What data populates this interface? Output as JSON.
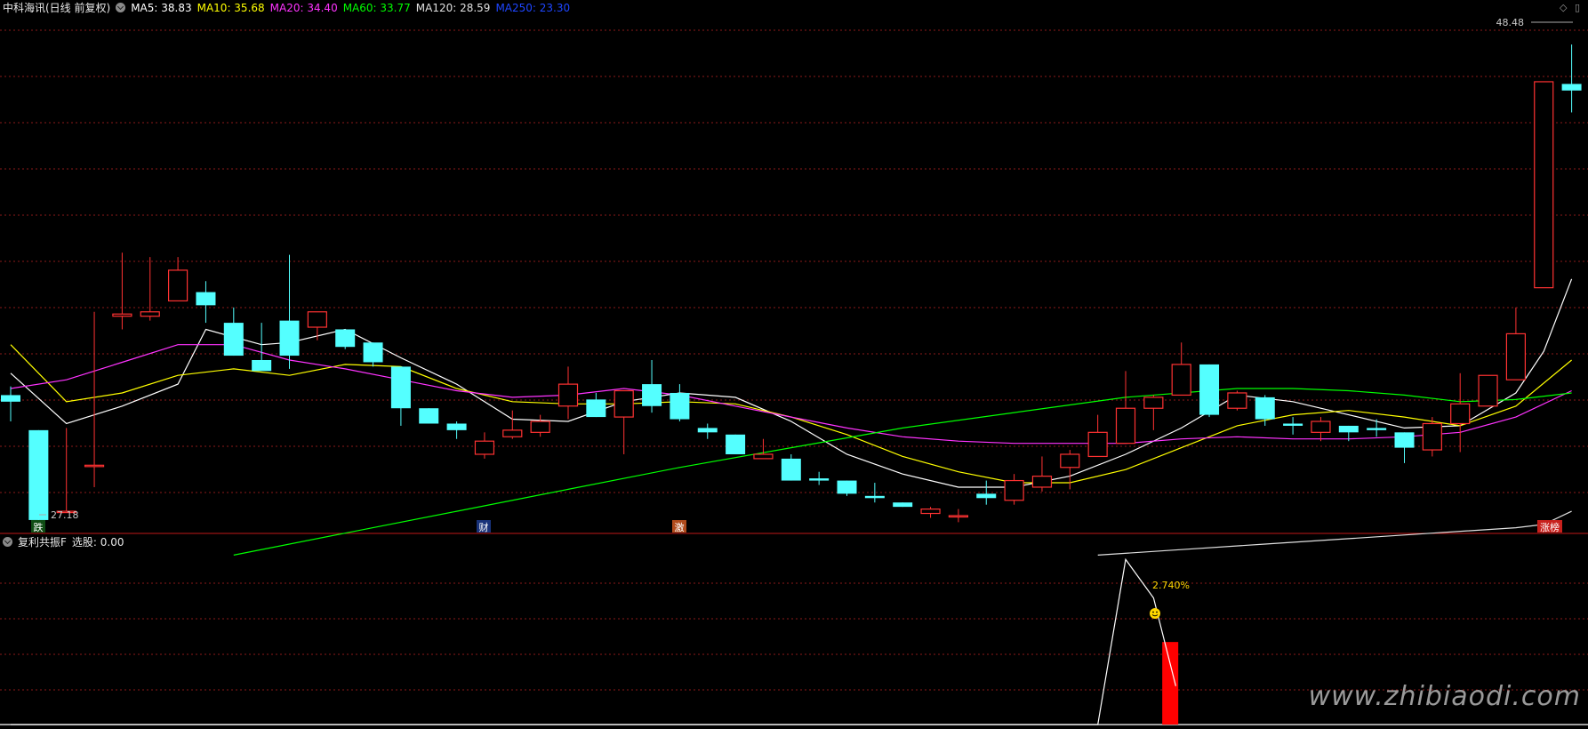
{
  "main_header": {
    "title": "中科海讯(日线 前复权)",
    "ma": [
      {
        "label": "MA5: 38.83",
        "color": "#ffffff"
      },
      {
        "label": "MA10: 35.68",
        "color": "#ffff00"
      },
      {
        "label": "MA20: 34.40",
        "color": "#ff33ff"
      },
      {
        "label": "MA60: 33.77",
        "color": "#00ff00"
      },
      {
        "label": "MA120: 28.59",
        "color": "#e0e0e0"
      },
      {
        "label": "MA250: 23.30",
        "color": "#1e46ff"
      }
    ]
  },
  "sub_header": {
    "title": "复利共振F",
    "value_label": "选股: 0.00"
  },
  "annotations": {
    "high_label": "48.48",
    "low_label": "27.18",
    "marker_die": "跌",
    "marker_cai": "财",
    "marker_ji": "激",
    "marker_zhangting": "涨榜",
    "pct_label": "2.740%"
  },
  "watermark": "www.zhibiaodi.com",
  "colors": {
    "up": "#ff3232",
    "down": "#54ffff",
    "grid": "#8b1a1a",
    "ma5": "#ffffff",
    "ma10": "#ffff00",
    "ma20": "#ff33ff",
    "ma60": "#00ff00",
    "ma120": "#e0e0e0",
    "signal_bar": "#ff0000"
  },
  "chart_data": [
    {
      "type": "candlestick",
      "ylim": [
        27.0,
        49.8
      ],
      "candles": [
        [
          32.5,
          32.9,
          32.2,
          31.3
        ],
        [
          30.9,
          30.9,
          26.8,
          26.7
        ],
        [
          27.2,
          31.0,
          27.2,
          28.3
        ],
        [
          29.3,
          36.3,
          29.3,
          28.3
        ],
        [
          36.1,
          39.0,
          36.2,
          35.5
        ],
        [
          36.1,
          38.8,
          36.3,
          35.9
        ],
        [
          36.8,
          38.8,
          38.2,
          36.8
        ],
        [
          37.2,
          37.7,
          36.6,
          35.8
        ],
        [
          35.8,
          36.5,
          34.3,
          34.3
        ],
        [
          34.1,
          35.8,
          33.6,
          33.7
        ],
        [
          35.9,
          38.9,
          34.3,
          33.7
        ],
        [
          35.6,
          35.9,
          36.3,
          35.0
        ],
        [
          35.5,
          35.5,
          34.7,
          34.6
        ],
        [
          34.9,
          34.9,
          34.0,
          33.8
        ],
        [
          33.8,
          33.8,
          31.9,
          31.1
        ],
        [
          31.9,
          31.9,
          31.2,
          31.2
        ],
        [
          31.2,
          31.3,
          30.9,
          30.5
        ],
        [
          29.8,
          30.8,
          30.4,
          29.6
        ],
        [
          30.6,
          31.8,
          30.9,
          30.5
        ],
        [
          30.8,
          31.6,
          31.3,
          30.6
        ],
        [
          32.0,
          33.8,
          33.0,
          31.4
        ],
        [
          32.3,
          32.6,
          31.5,
          31.5
        ],
        [
          31.5,
          32.1,
          32.7,
          29.8
        ],
        [
          33.0,
          34.1,
          32.0,
          31.7
        ],
        [
          32.6,
          33.0,
          31.4,
          31.3
        ],
        [
          31.0,
          31.2,
          30.8,
          30.5
        ],
        [
          30.7,
          30.7,
          29.8,
          29.8
        ],
        [
          29.6,
          30.5,
          29.8,
          29.6
        ],
        [
          29.6,
          29.8,
          28.6,
          28.6
        ],
        [
          28.7,
          29.0,
          28.6,
          28.4
        ],
        [
          28.6,
          28.6,
          28.0,
          27.9
        ],
        [
          27.9,
          28.5,
          27.8,
          27.6
        ],
        [
          27.6,
          27.6,
          27.4,
          27.4
        ],
        [
          27.1,
          27.4,
          27.3,
          26.9
        ],
        [
          27.0,
          27.3,
          27.0,
          26.7
        ],
        [
          28.0,
          28.6,
          27.8,
          27.5
        ],
        [
          27.7,
          28.9,
          28.6,
          27.5
        ],
        [
          28.3,
          29.7,
          28.8,
          28.1
        ],
        [
          29.2,
          30.0,
          29.8,
          28.2
        ],
        [
          29.7,
          31.6,
          30.8,
          30.0
        ],
        [
          30.3,
          33.6,
          31.9,
          30.3
        ],
        [
          31.9,
          32.5,
          32.4,
          30.9
        ],
        [
          32.5,
          34.9,
          33.9,
          32.5
        ],
        [
          33.9,
          33.9,
          31.6,
          31.5
        ],
        [
          31.9,
          32.7,
          32.6,
          31.8
        ],
        [
          32.4,
          32.5,
          31.4,
          31.1
        ],
        [
          31.2,
          31.5,
          31.1,
          30.7
        ],
        [
          30.8,
          31.5,
          31.3,
          30.4
        ],
        [
          31.1,
          31.1,
          30.8,
          30.4
        ],
        [
          31.0,
          31.4,
          30.9,
          30.6
        ],
        [
          30.8,
          30.8,
          30.1,
          29.4
        ],
        [
          30.0,
          31.5,
          31.2,
          29.7
        ],
        [
          31.2,
          33.5,
          32.1,
          29.9
        ],
        [
          32.0,
          33.4,
          33.4,
          32.0
        ],
        [
          33.2,
          36.5,
          35.3,
          33.2
        ],
        [
          37.4,
          39.8,
          46.8,
          37.4
        ],
        [
          46.7,
          48.5,
          46.4,
          45.4
        ]
      ]
    },
    {
      "type": "line",
      "series": [
        {
          "name": "MA5",
          "x": [
            0,
            2,
            4,
            6,
            7,
            9,
            10,
            12,
            14,
            16,
            18,
            20,
            22,
            24,
            26,
            28,
            30,
            32,
            34,
            36,
            38,
            40,
            42,
            44,
            46,
            48,
            50,
            52,
            54,
            55,
            56
          ],
          "values": [
            33.5,
            31.2,
            32.0,
            33.0,
            35.5,
            34.8,
            34.9,
            35.5,
            34.2,
            33.0,
            31.4,
            31.3,
            32.2,
            32.6,
            32.4,
            31.3,
            29.8,
            28.9,
            28.3,
            28.3,
            28.8,
            29.8,
            31.0,
            32.5,
            32.2,
            31.6,
            31.0,
            31.1,
            32.6,
            34.5,
            37.8
          ]
        },
        {
          "name": "MA10",
          "x": [
            0,
            2,
            4,
            6,
            8,
            10,
            12,
            14,
            16,
            18,
            20,
            22,
            24,
            26,
            28,
            30,
            32,
            34,
            36,
            38,
            40,
            42,
            44,
            46,
            48,
            50,
            52,
            54,
            56
          ],
          "values": [
            34.8,
            32.2,
            32.6,
            33.4,
            33.7,
            33.4,
            33.9,
            33.8,
            32.8,
            32.2,
            32.1,
            32.1,
            32.2,
            32.1,
            31.5,
            30.7,
            29.7,
            29.0,
            28.5,
            28.5,
            29.1,
            30.1,
            31.1,
            31.6,
            31.8,
            31.5,
            31.1,
            32.0,
            34.1
          ]
        },
        {
          "name": "MA20",
          "x": [
            0,
            2,
            4,
            6,
            8,
            10,
            12,
            14,
            16,
            18,
            20,
            22,
            24,
            26,
            28,
            30,
            32,
            34,
            36,
            38,
            40,
            42,
            44,
            46,
            48,
            50,
            52,
            54,
            56
          ],
          "values": [
            32.8,
            33.2,
            34.0,
            34.8,
            34.8,
            34.1,
            33.7,
            33.2,
            32.7,
            32.4,
            32.5,
            32.8,
            32.5,
            32.0,
            31.5,
            31.0,
            30.6,
            30.4,
            30.3,
            30.3,
            30.3,
            30.5,
            30.6,
            30.5,
            30.5,
            30.6,
            30.8,
            31.5,
            32.7
          ]
        },
        {
          "name": "MA60",
          "x": [
            8,
            12,
            16,
            20,
            24,
            28,
            32,
            36,
            40,
            44,
            46,
            48,
            50,
            52,
            54,
            56
          ],
          "values": [
            25.2,
            26.2,
            27.2,
            28.2,
            29.2,
            30.1,
            31.0,
            31.7,
            32.4,
            32.8,
            32.8,
            32.7,
            32.5,
            32.2,
            32.3,
            32.6
          ]
        },
        {
          "name": "MA120",
          "x": [
            39,
            42,
            45,
            48,
            51,
            54,
            55,
            56
          ],
          "values": [
            25.2,
            25.45,
            25.7,
            25.95,
            26.2,
            26.45,
            26.6,
            27.2
          ]
        }
      ]
    },
    {
      "type": "line",
      "series": [
        {
          "name": "选股",
          "x": [
            0,
            39,
            40,
            41,
            41.8
          ],
          "values": [
            0,
            0,
            6.0,
            4.6,
            1.4
          ]
        }
      ],
      "bar": {
        "x": 41.6,
        "value": 3.0
      },
      "ylim": [
        0,
        6.3
      ]
    }
  ]
}
